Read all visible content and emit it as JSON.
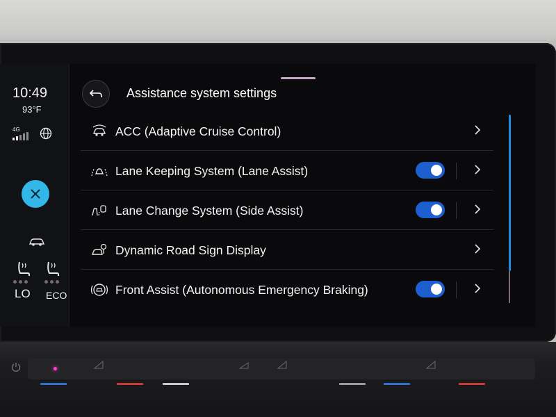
{
  "status": {
    "time": "10:49",
    "temperature": "93°F",
    "network": "4G"
  },
  "climate": {
    "left_seat_label": "LO",
    "right_seat_label": "ECO"
  },
  "header": {
    "title": "Assistance system settings",
    "back_icon": "back-arrow-icon"
  },
  "settings": [
    {
      "label": "ACC (Adaptive Cruise Control)",
      "icon": "acc-icon",
      "toggle": null
    },
    {
      "label": "Lane Keeping System (Lane Assist)",
      "icon": "lane-assist-icon",
      "toggle": true
    },
    {
      "label": "Lane Change System (Side Assist)",
      "icon": "side-assist-icon",
      "toggle": true
    },
    {
      "label": "Dynamic Road Sign Display",
      "icon": "road-sign-icon",
      "toggle": null
    },
    {
      "label": "Front Assist (Autonomous Emergency Braking)",
      "icon": "front-assist-icon",
      "toggle": true
    }
  ],
  "colors": {
    "accent_blue": "#1e5fd0",
    "close_button": "#33b7e8",
    "scrollbar": "#1e8fe0"
  }
}
